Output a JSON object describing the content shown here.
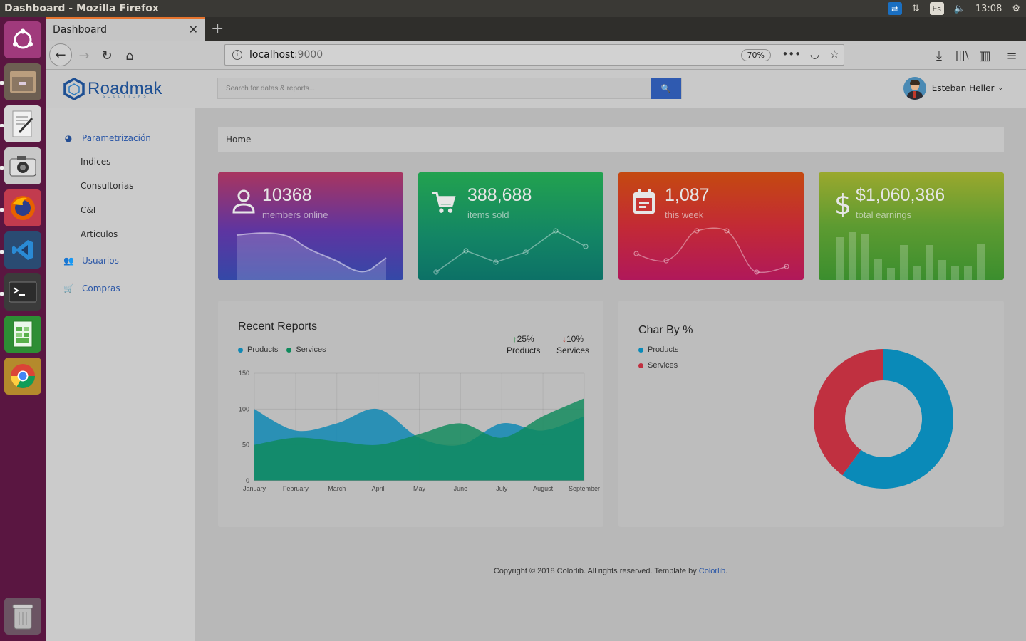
{
  "os": {
    "window_title": "Dashboard - Mozilla Firefox",
    "keyboard_layout": "Es",
    "clock": "13:08"
  },
  "launcher": {
    "items": [
      "ubuntu-dash-icon",
      "files-icon",
      "text-editor-icon",
      "camera-icon",
      "firefox-icon",
      "vscode-icon",
      "terminal-icon",
      "spreadsheet-icon",
      "chrome-icon",
      "trash-icon"
    ]
  },
  "browser": {
    "tab_title": "Dashboard",
    "url_host": "localhost",
    "url_port": ":9000",
    "zoom": "70%"
  },
  "app": {
    "brand_name": "Roadmak",
    "brand_sub": "SOLUTIONS",
    "search_placeholder": "Search for datas & reports...",
    "user_name": "Esteban Heller",
    "breadcrumb": "Home",
    "menu": {
      "parametrizacion": "Parametrización",
      "sub": [
        "Indices",
        "Consultorias",
        "C&I",
        "Articulos"
      ],
      "usuarios": "Usuarios",
      "compras": "Compras"
    }
  },
  "stats": [
    {
      "value": "10368",
      "label": "members online",
      "icon": "user-icon",
      "spark": "area-line"
    },
    {
      "value": "388,688",
      "label": "items sold",
      "icon": "cart-icon",
      "spark": "line-points"
    },
    {
      "value": "1,087",
      "label": "this week",
      "icon": "calendar-icon",
      "spark": "curve-points"
    },
    {
      "value": "$1,060,386",
      "label": "total earnings",
      "icon": "dollar-icon",
      "spark": "bars"
    }
  ],
  "reports": {
    "title": "Recent Reports",
    "legend": [
      "Products",
      "Services"
    ],
    "kpis": [
      {
        "pct": "25%",
        "label": "Products",
        "dir": "up",
        "color": "#1f8a3a"
      },
      {
        "pct": "10%",
        "label": "Services",
        "dir": "down",
        "color": "#c0392b"
      }
    ]
  },
  "pie": {
    "title": "Char By %",
    "legend": [
      "Products",
      "Services"
    ]
  },
  "footer": {
    "text": "Copyright © 2018 Colorlib. All rights reserved. Template by ",
    "link": "Colorlib",
    "end": "."
  },
  "colors": {
    "products": "#1088b4",
    "services": "#0f8a5c",
    "pie_products": "#0a8ab8",
    "pie_services": "#c03040",
    "accent": "#2a56a6"
  },
  "chart_data": [
    {
      "type": "area",
      "title": "Recent Reports",
      "categories": [
        "January",
        "February",
        "March",
        "April",
        "May",
        "June",
        "July",
        "August",
        "September"
      ],
      "ylim": [
        0,
        150
      ],
      "yticks": [
        0,
        50,
        100,
        150
      ],
      "series": [
        {
          "name": "Products",
          "values": [
            100,
            70,
            80,
            100,
            60,
            50,
            80,
            70,
            90
          ]
        },
        {
          "name": "Services",
          "values": [
            50,
            60,
            55,
            50,
            65,
            80,
            60,
            90,
            115
          ]
        }
      ]
    },
    {
      "type": "pie",
      "title": "Char By %",
      "labels": [
        "Products",
        "Services"
      ],
      "values": [
        60,
        40
      ],
      "donut": true
    }
  ]
}
